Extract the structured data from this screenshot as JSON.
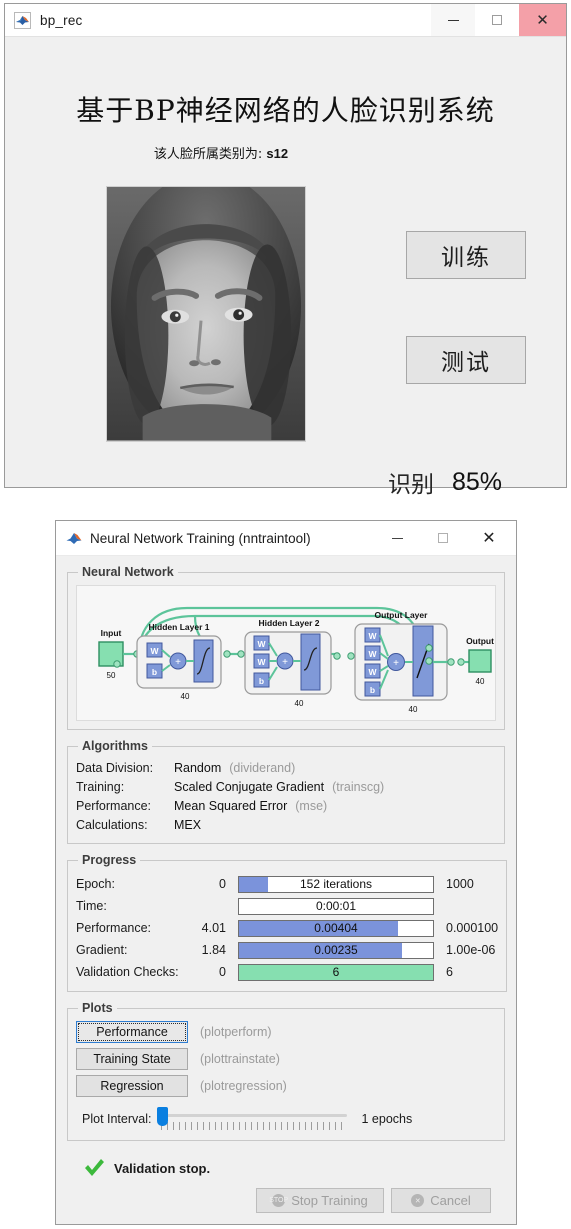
{
  "app_window": {
    "title": "bp_rec",
    "icon": "matlab-icon",
    "controls": {
      "minimize": "minimize-icon",
      "maximize": "maximize-icon",
      "close": "close-icon"
    },
    "heading": "基于BP神经网络的人脸识别系统",
    "class_label": "该人脸所属类别为:",
    "class_value": "s12",
    "face_image_alt": "grayscale-face-photo",
    "buttons": {
      "train": "训练",
      "test": "测试"
    },
    "recognition": {
      "label": "识别",
      "value": "85%"
    },
    "colors": {
      "close_button": "#f4a0a8",
      "window_bg": "#f0f0f0",
      "button_bg": "#e4e4e4"
    }
  },
  "nn_window": {
    "title": "Neural Network Training (nntraintool)",
    "icon": "matlab-icon",
    "controls": {
      "minimize": "minimize-icon",
      "maximize": "maximize-icon",
      "close": "close-icon"
    },
    "neural_network": {
      "legend": "Neural Network",
      "input_label": "Input",
      "input_size": "50",
      "layers": [
        {
          "name": "Hidden Layer 1",
          "size": "40",
          "blocks": [
            "W",
            "b"
          ]
        },
        {
          "name": "Hidden Layer 2",
          "size": "40",
          "blocks": [
            "W",
            "W",
            "b"
          ]
        },
        {
          "name": "Output Layer",
          "size": "40",
          "blocks": [
            "W",
            "W",
            "W",
            "b"
          ]
        }
      ],
      "output_label": "Output",
      "output_size": "40"
    },
    "algorithms": {
      "legend": "Algorithms",
      "rows": [
        {
          "key": "Data Division:",
          "value": "Random",
          "fn": "(dividerand)"
        },
        {
          "key": "Training:",
          "value": "Scaled Conjugate Gradient",
          "fn": "(trainscg)"
        },
        {
          "key": "Performance:",
          "value": "Mean Squared Error",
          "fn": "(mse)"
        },
        {
          "key": "Calculations:",
          "value": "MEX",
          "fn": ""
        }
      ]
    },
    "progress": {
      "legend": "Progress",
      "rows": [
        {
          "label": "Epoch:",
          "start": "0",
          "bar_text": "152 iterations",
          "end": "1000",
          "fill_pct": 15,
          "color": "#7b93db"
        },
        {
          "label": "Time:",
          "start": "",
          "bar_text": "0:00:01",
          "end": "",
          "fill_pct": 0,
          "color": "#7b93db"
        },
        {
          "label": "Performance:",
          "start": "4.01",
          "bar_text": "0.00404",
          "end": "0.000100",
          "fill_pct": 82,
          "color": "#7b93db"
        },
        {
          "label": "Gradient:",
          "start": "1.84",
          "bar_text": "0.00235",
          "end": "1.00e-06",
          "fill_pct": 84,
          "color": "#7b93db"
        },
        {
          "label": "Validation Checks:",
          "start": "0",
          "bar_text": "6",
          "end": "6",
          "fill_pct": 100,
          "color": "#86dfb0"
        }
      ]
    },
    "plots": {
      "legend": "Plots",
      "buttons": [
        {
          "label": "Performance",
          "fn": "(plotperform)",
          "focused": true
        },
        {
          "label": "Training State",
          "fn": "(plottrainstate)",
          "focused": false
        },
        {
          "label": "Regression",
          "fn": "(plotregression)",
          "focused": false
        }
      ],
      "interval_label": "Plot Interval:",
      "interval_value": "1 epochs"
    },
    "footer": {
      "status_icon": "green-check-icon",
      "status_text": "Validation stop.",
      "stop_button": "Stop Training",
      "cancel_button": "Cancel"
    },
    "colors": {
      "bar_blue": "#7b93db",
      "bar_green": "#86dfb0",
      "slider_blue": "#0a7fe0",
      "check_green": "#3cb93c"
    }
  }
}
